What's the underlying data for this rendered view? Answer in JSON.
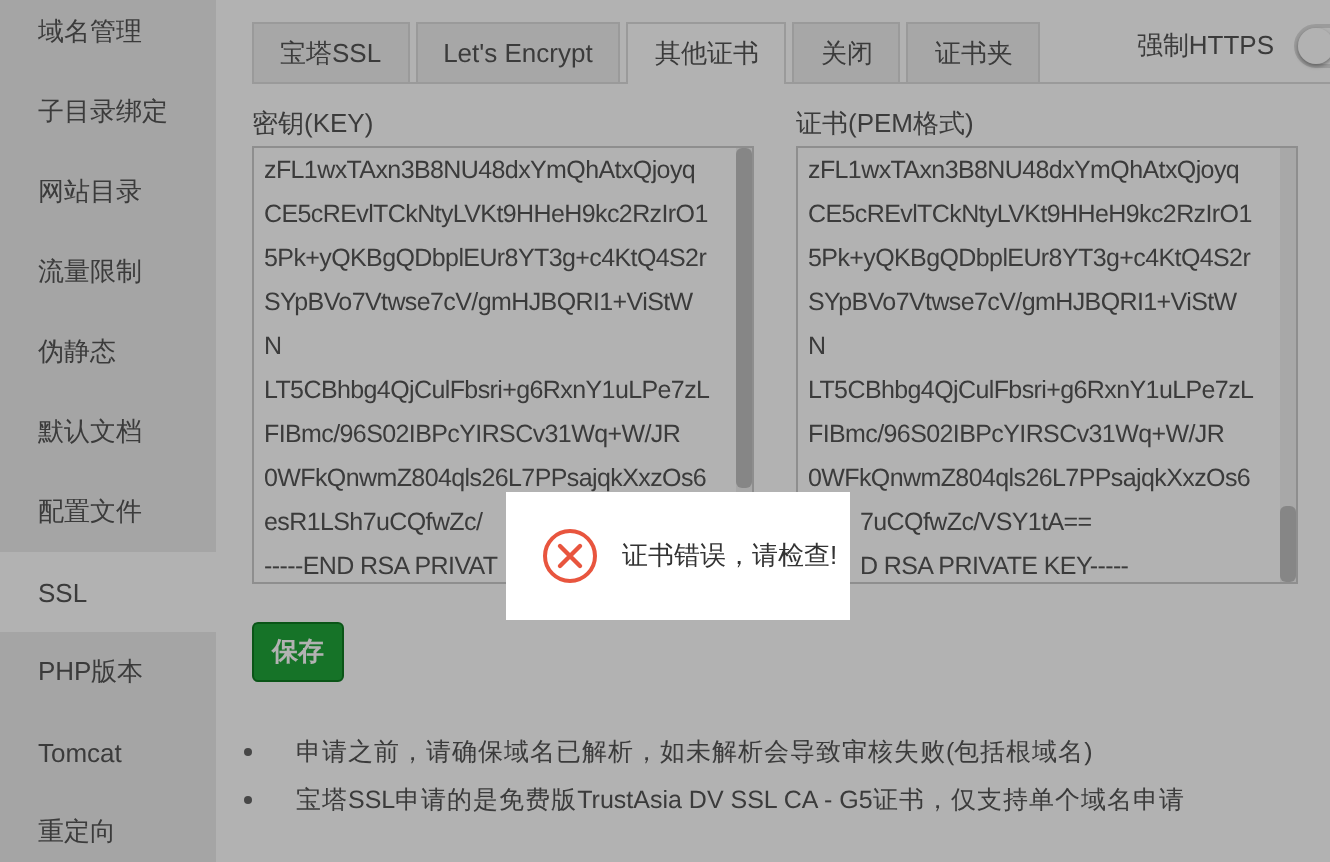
{
  "sidebar": {
    "items": [
      {
        "label": "域名管理",
        "selected": false
      },
      {
        "label": "子目录绑定",
        "selected": false
      },
      {
        "label": "网站目录",
        "selected": false
      },
      {
        "label": "流量限制",
        "selected": false
      },
      {
        "label": "伪静态",
        "selected": false
      },
      {
        "label": "默认文档",
        "selected": false
      },
      {
        "label": "配置文件",
        "selected": false
      },
      {
        "label": "SSL",
        "selected": true
      },
      {
        "label": "PHP版本",
        "selected": false
      },
      {
        "label": "Tomcat",
        "selected": false
      },
      {
        "label": "重定向",
        "selected": false
      }
    ]
  },
  "tabs": [
    {
      "label": "宝塔SSL",
      "selected": false
    },
    {
      "label": "Let's Encrypt",
      "selected": false
    },
    {
      "label": "其他证书",
      "selected": true
    },
    {
      "label": "关闭",
      "selected": false
    },
    {
      "label": "证书夹",
      "selected": false
    }
  ],
  "force_https": {
    "label": "强制HTTPS",
    "on": false
  },
  "key_field": {
    "label": "密钥(KEY)",
    "lines": [
      "zFL1wxTAxn3B8NU48dxYmQhAtxQjoyq",
      "CE5cREvlTCkNtyLVKt9HHeH9kc2RzIrO1",
      "5Pk+yQKBgQDbplEUr8YT3g+c4KtQ4S2r",
      "SYpBVo7Vtwse7cV/gmHJBQRI1+ViStW",
      "N",
      "LT5CBhbg4QjCulFbsri+g6RxnY1uLPe7zL",
      "FIBmc/96S02IBPcYIRSCv31Wq+W/JR",
      "0WFkQnwmZ804qls26L7PPsajqkXxzOs6",
      "esR1LSh7uCQfwZc/",
      "-----END RSA PRIVAT"
    ]
  },
  "cert_field": {
    "label": "证书(PEM格式)",
    "lines": [
      "zFL1wxTAxn3B8NU48dxYmQhAtxQjoyq",
      "CE5cREvlTCkNtyLVKt9HHeH9kc2RzIrO1",
      "5Pk+yQKBgQDbplEUr8YT3g+c4KtQ4S2r",
      "SYpBVo7Vtwse7cV/gmHJBQRI1+ViStW",
      "N",
      "LT5CBhbg4QjCulFbsri+g6RxnY1uLPe7zL",
      "FIBmc/96S02IBPcYIRSCv31Wq+W/JR",
      "0WFkQnwmZ804qls26L7PPsajqkXxzOs6",
      "7uCQfwZc/VSY1tA==",
      "D RSA PRIVATE KEY-----"
    ]
  },
  "save_button": "保存",
  "notes": [
    "申请之前，请确保域名已解析，如未解析会导致审核失败(包括根域名)",
    "宝塔SSL申请的是免费版TrustAsia DV SSL CA - G5证书，仅支持单个域名申请"
  ],
  "toast": {
    "kind": "error",
    "message": "证书错误，请检查!"
  }
}
